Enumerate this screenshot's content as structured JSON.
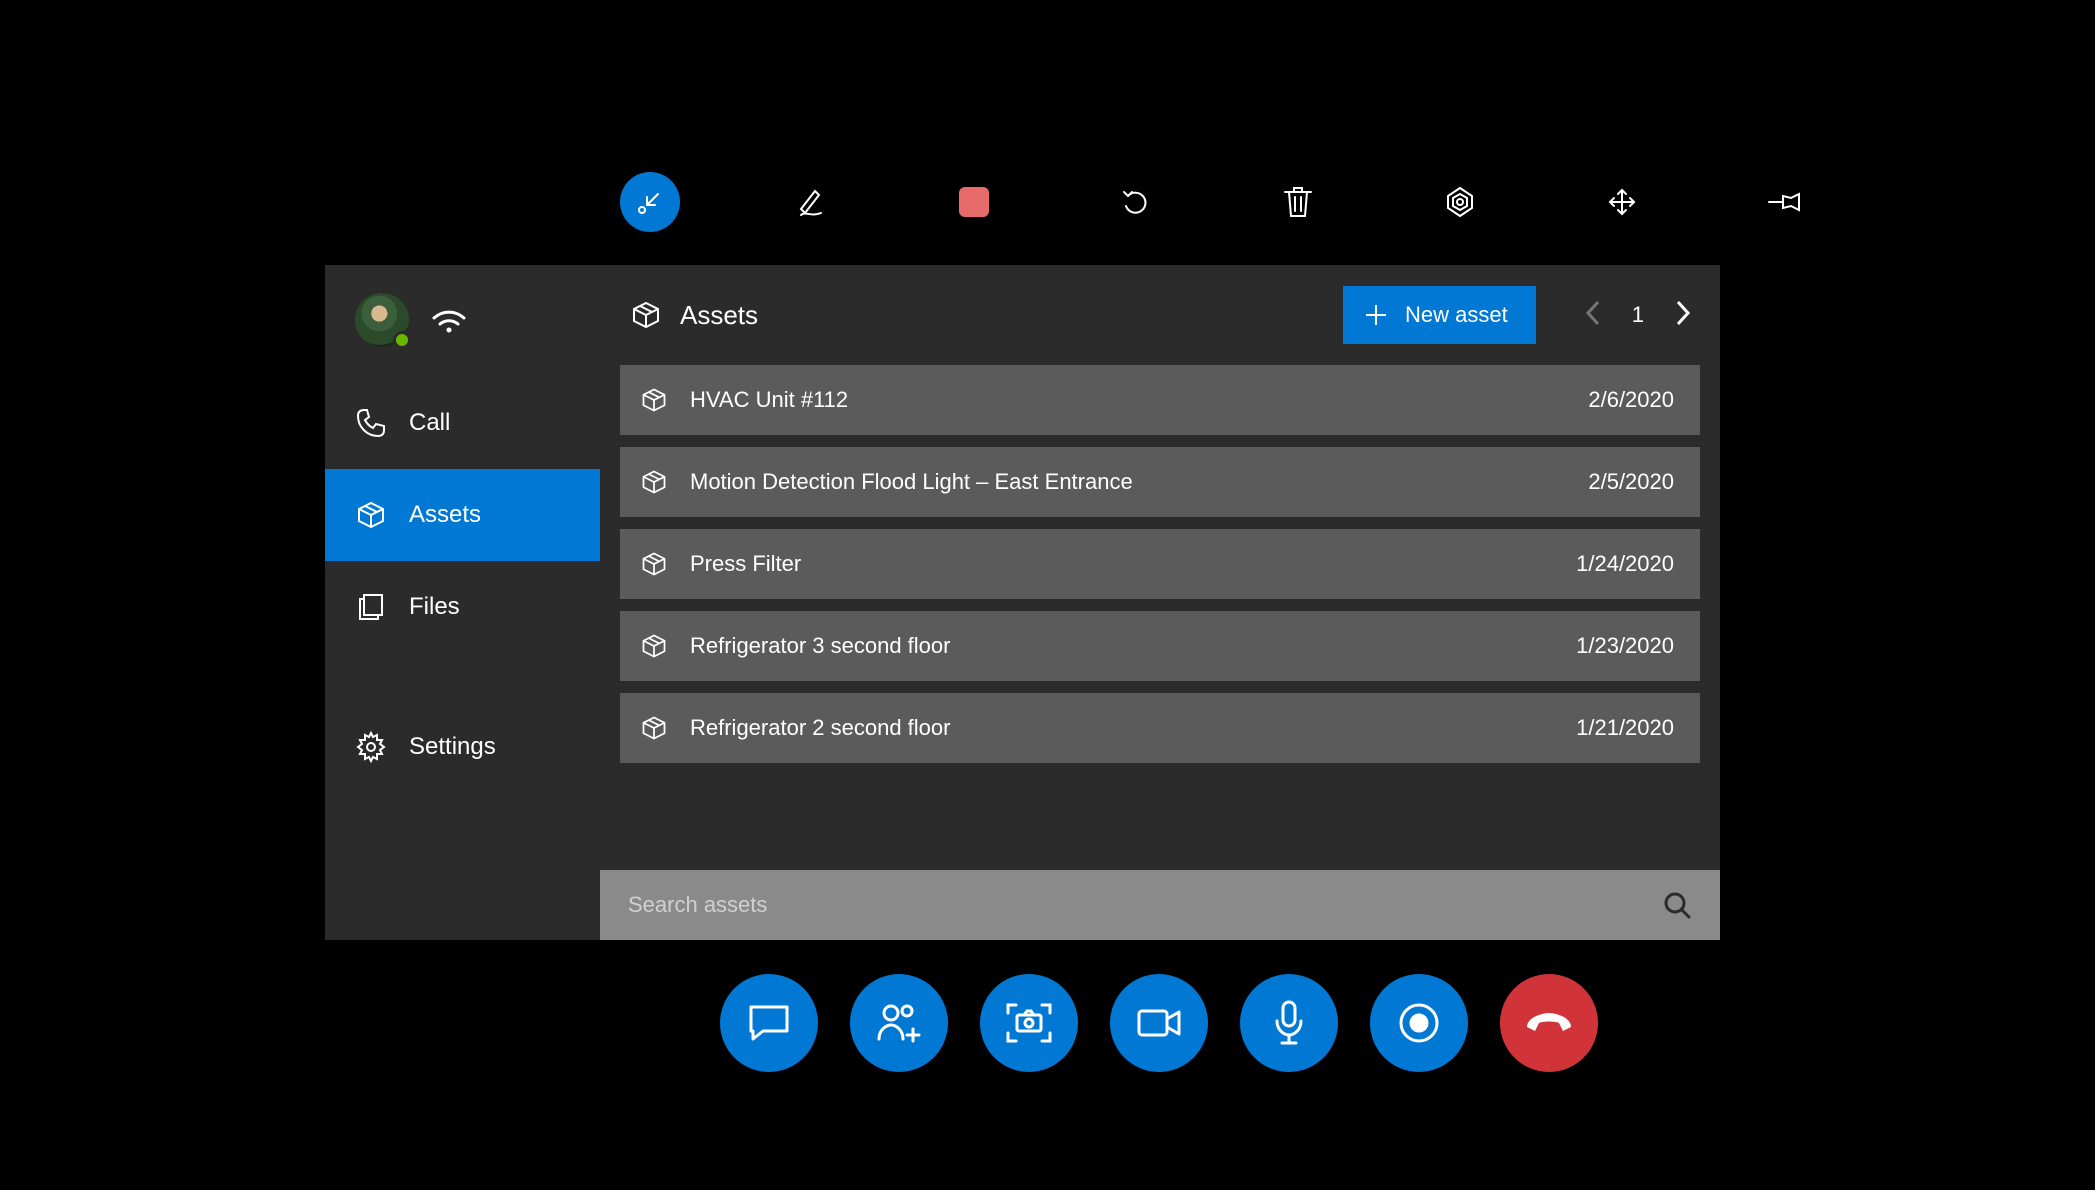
{
  "sidebar": {
    "nav": [
      {
        "id": "call",
        "label": "Call",
        "active": false
      },
      {
        "id": "assets",
        "label": "Assets",
        "active": true
      },
      {
        "id": "files",
        "label": "Files",
        "active": false
      },
      {
        "id": "settings",
        "label": "Settings",
        "active": false
      }
    ]
  },
  "header": {
    "title": "Assets",
    "new_asset_label": "New asset",
    "page": "1"
  },
  "assets": [
    {
      "name": "HVAC Unit #112",
      "date": "2/6/2020"
    },
    {
      "name": "Motion Detection Flood Light – East Entrance",
      "date": "2/5/2020"
    },
    {
      "name": "Press Filter",
      "date": "1/24/2020"
    },
    {
      "name": "Refrigerator 3 second floor",
      "date": "1/23/2020"
    },
    {
      "name": "Refrigerator 2 second floor",
      "date": "1/21/2020"
    }
  ],
  "search": {
    "placeholder": "Search assets"
  },
  "colors": {
    "accent": "#0078d4",
    "danger": "#d13438"
  }
}
